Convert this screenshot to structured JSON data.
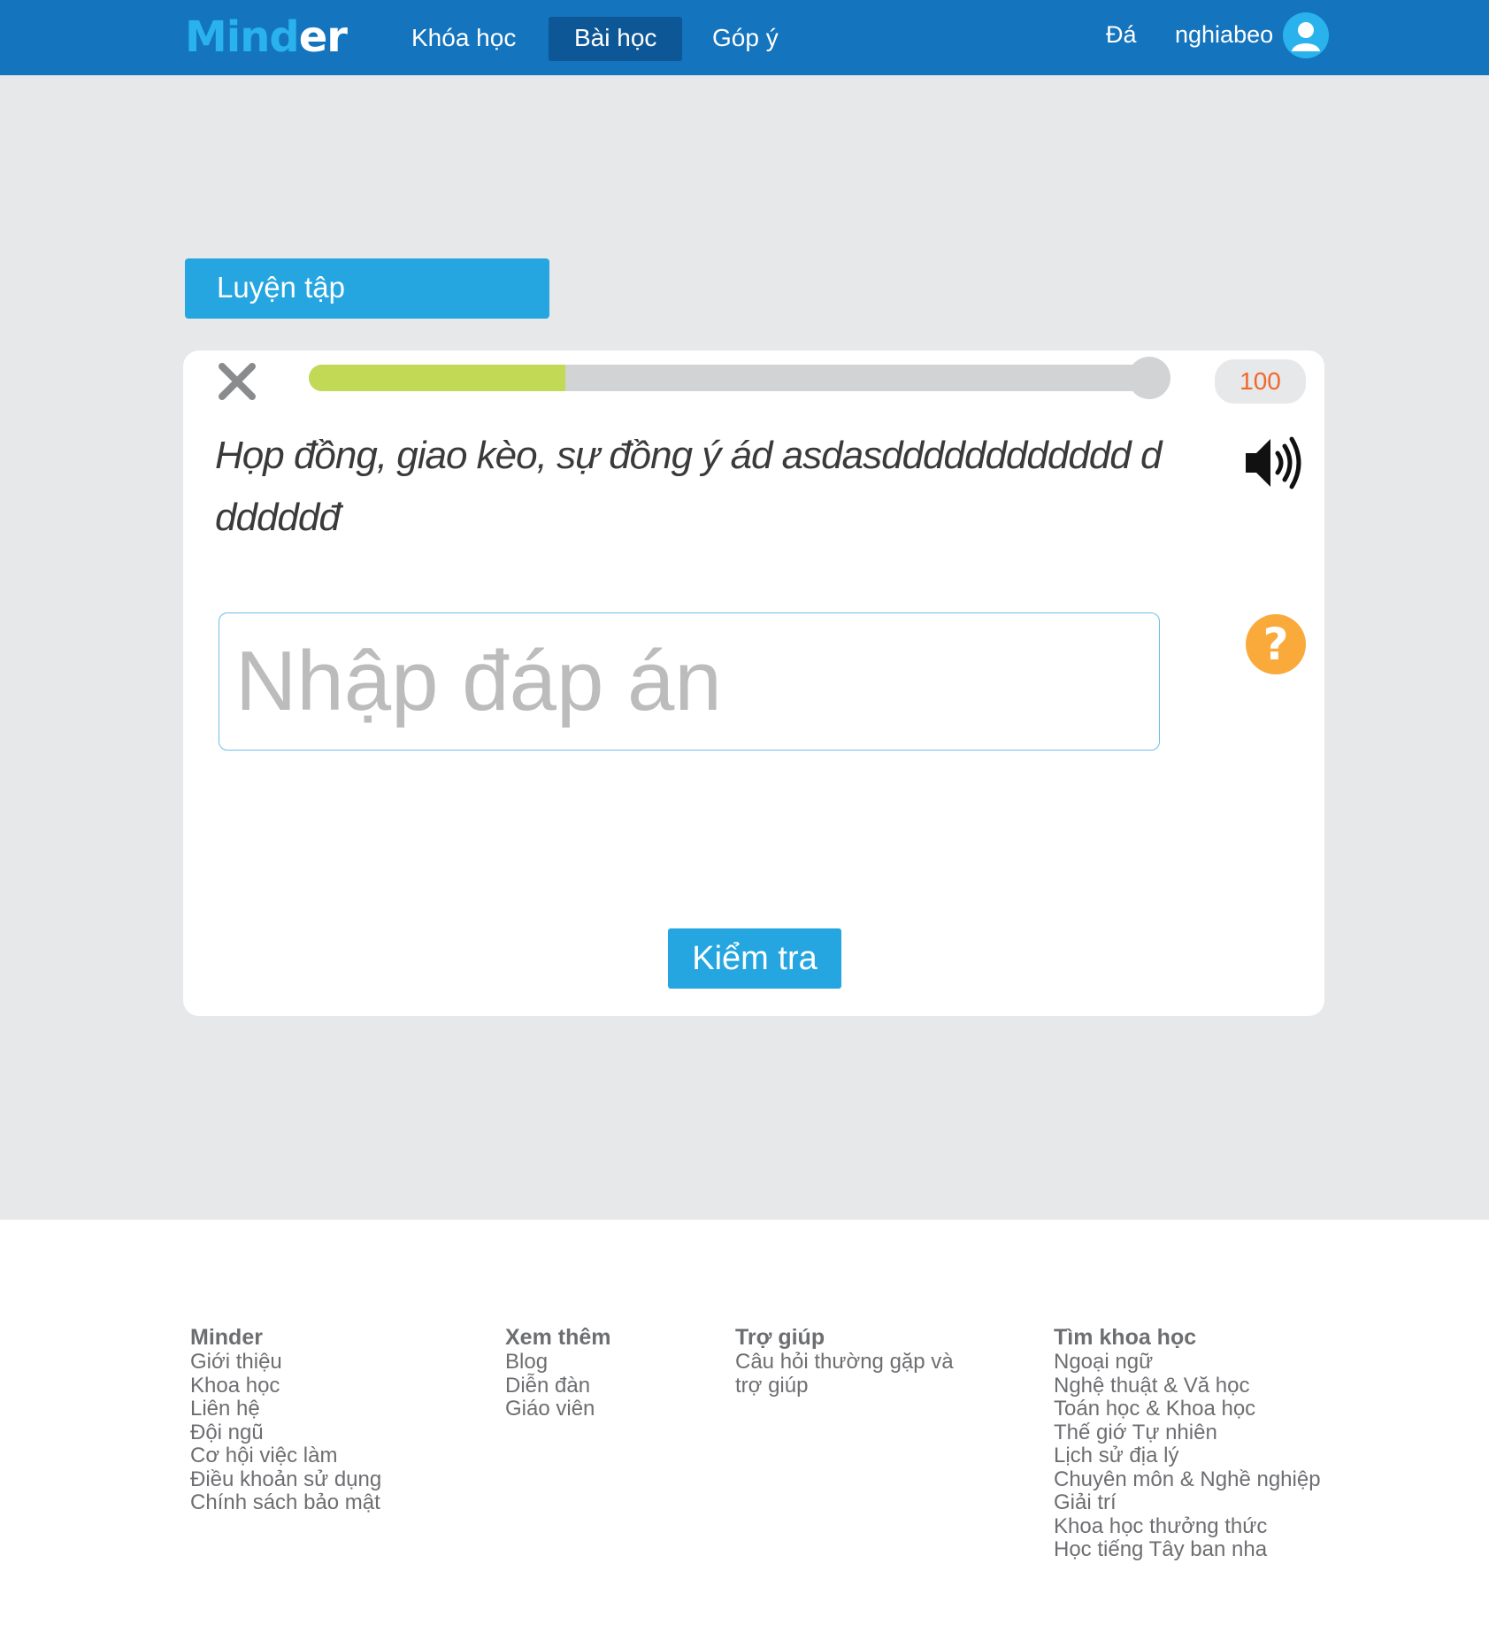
{
  "header": {
    "logo_part1": "Mind",
    "logo_part2": "er",
    "nav": [
      {
        "label": "Khóa học",
        "active": false
      },
      {
        "label": "Bài học",
        "active": true
      },
      {
        "label": "Góp ý",
        "active": false
      }
    ],
    "extra_link": "Đá",
    "username": "nghiabeo"
  },
  "practice": {
    "section_title": "Luyện tập",
    "progress_fraction": 0.3,
    "score": "100",
    "prompt": "Họp đồng, giao kèo, sự đồng ý ád asdasdddddddddddd ddddddđ",
    "answer_placeholder": "Nhập đáp án",
    "answer_value": "",
    "check_label": "Kiểm tra",
    "help_symbol": "?"
  },
  "footer": {
    "columns": [
      {
        "title": "Minder",
        "links": [
          "Giới thiệu",
          "Khoa học",
          "Liên hệ",
          "Đội ngũ",
          "Cơ hội việc làm",
          "Điều khoản sử dụng",
          "Chính sách bảo mật"
        ]
      },
      {
        "title": "Xem thêm",
        "links": [
          "Blog",
          "Diễn đàn",
          "Giáo viên"
        ]
      },
      {
        "title": "Trợ giúp",
        "links": [
          "Câu hỏi thường gặp và",
          "trợ giúp"
        ]
      },
      {
        "title": "Tìm khoa học",
        "links": [
          "Ngoại ngữ",
          "Nghệ thuật & Vă học",
          "Toán học & Khoa học",
          "Thế giớ Tự nhiên",
          "Lịch sử địa lý",
          "Chuyên môn & Nghề nghiệp",
          "Giải trí",
          "Khoa học thưởng thức",
          "Học tiếng Tây ban nha"
        ]
      }
    ]
  },
  "colors": {
    "header_bg": "#1474bd",
    "accent": "#25a6e0",
    "progress_fill": "#c2d955",
    "score_text": "#f2672a",
    "help_bg": "#f9aa3b"
  }
}
